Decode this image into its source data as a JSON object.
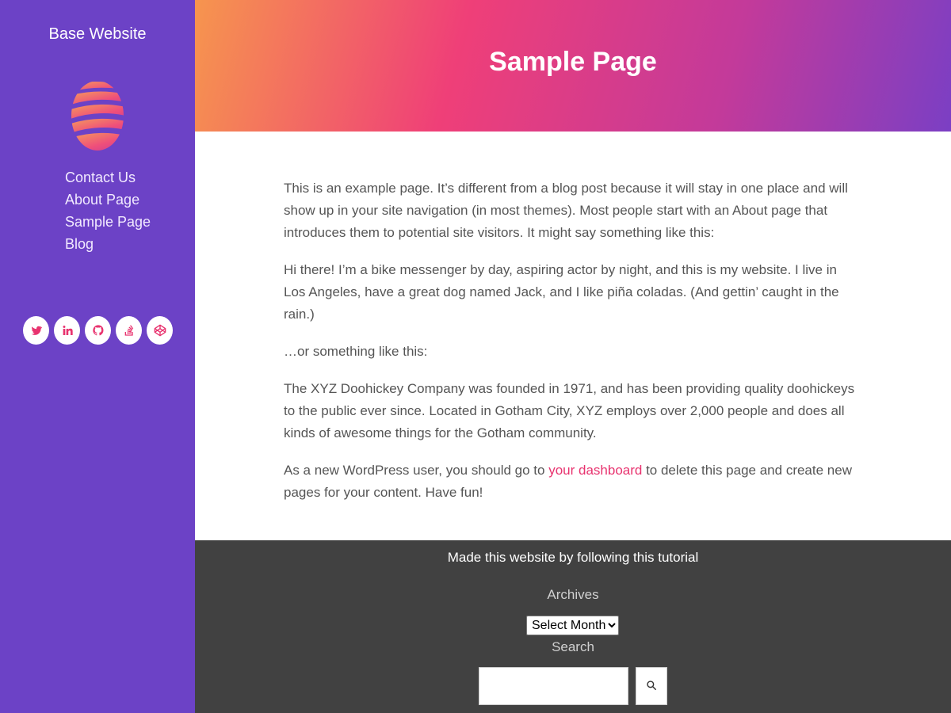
{
  "sidebar": {
    "site_title": "Base Website",
    "nav": [
      {
        "label": "Contact Us"
      },
      {
        "label": "About Page"
      },
      {
        "label": "Sample Page"
      },
      {
        "label": "Blog"
      }
    ],
    "social_icons": [
      "twitter-icon",
      "linkedin-icon",
      "github-icon",
      "stackoverflow-icon",
      "codepen-icon"
    ]
  },
  "header": {
    "title": "Sample Page"
  },
  "content": {
    "p1": "This is an example page. It’s different from a blog post because it will stay in one place and will show up in your site navigation (in most themes). Most people start with an About page that introduces them to potential site visitors. It might say something like this:",
    "p2": "Hi there! I’m a bike messenger by day, aspiring actor by night, and this is my website. I live in Los Angeles, have a great dog named Jack, and I like piña coladas. (And gettin’ caught in the rain.)",
    "p3": "…or something like this:",
    "p4": "The XYZ Doohickey Company was founded in 1971, and has been providing quality doohickeys to the public ever since. Located in Gotham City, XYZ employs over 2,000 people and does all kinds of awesome things for the Gotham community.",
    "p5_before": "As a new WordPress user, you should go to ",
    "p5_link": "your dashboard",
    "p5_after": " to delete this page and create new pages for your content. Have fun!"
  },
  "footer": {
    "made_text": "Made this website by following this tutorial",
    "archives_title": "Archives",
    "archives_select": "Select Month",
    "search_title": "Search"
  },
  "colors": {
    "sidebar_bg": "#6c42c6",
    "accent": "#e8336f",
    "footer_bg": "#414141"
  }
}
